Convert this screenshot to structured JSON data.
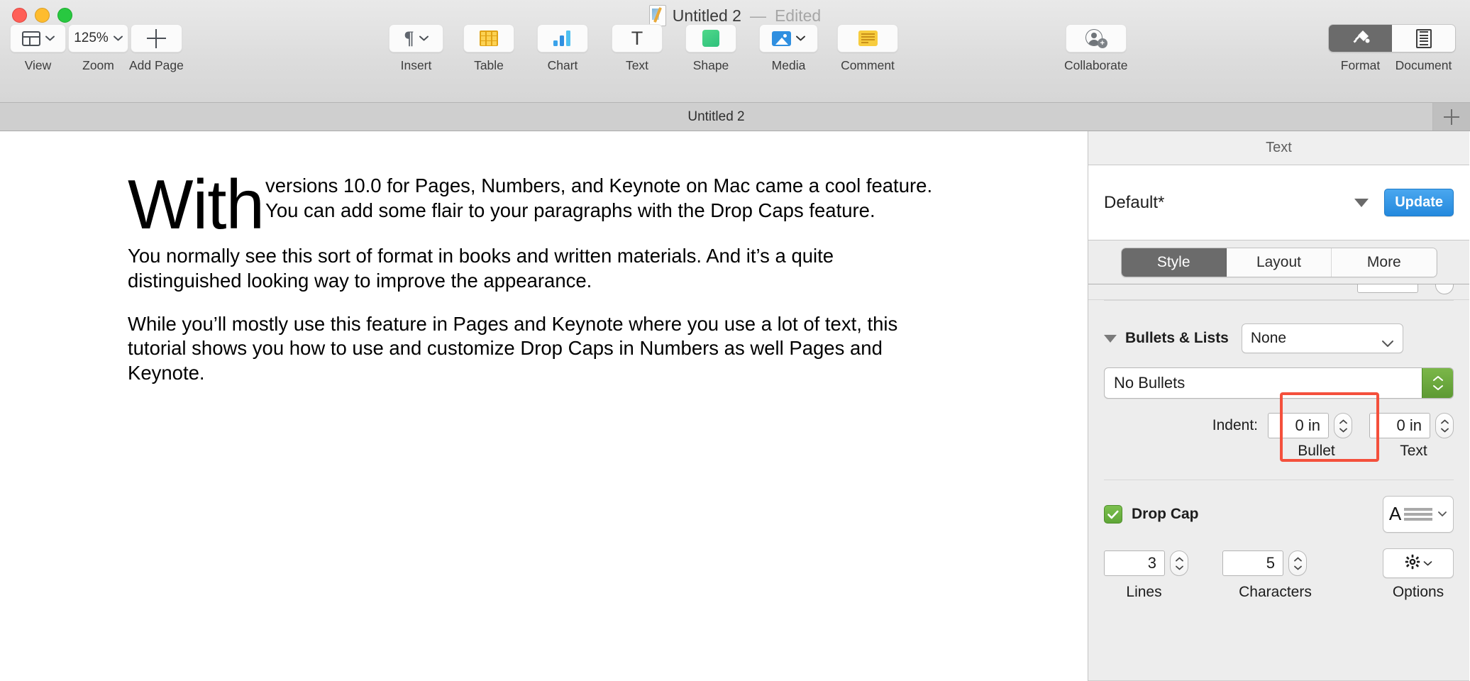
{
  "window": {
    "title_main": "Untitled 2",
    "title_sep": "—",
    "title_state": "Edited",
    "traffic_lights": [
      "close",
      "minimize",
      "zoom"
    ]
  },
  "toolbar": {
    "items": [
      {
        "name": "view",
        "label": "View",
        "icon": "sidebar-layout-icon",
        "has_chevron": true,
        "value": ""
      },
      {
        "name": "zoom",
        "label": "Zoom",
        "icon": "zoom-percent-icon",
        "has_chevron": true,
        "value": "125%"
      },
      {
        "name": "add-page",
        "label": "Add Page",
        "icon": "plus-icon",
        "has_chevron": false,
        "value": ""
      },
      {
        "name": "insert",
        "label": "Insert",
        "icon": "pilcrow-icon",
        "has_chevron": true,
        "value": "¶"
      },
      {
        "name": "table",
        "label": "Table",
        "icon": "table-grid-icon",
        "has_chevron": false,
        "value": ""
      },
      {
        "name": "chart",
        "label": "Chart",
        "icon": "bar-chart-icon",
        "has_chevron": false,
        "value": ""
      },
      {
        "name": "text",
        "label": "Text",
        "icon": "text-t-icon",
        "has_chevron": false,
        "value": "T"
      },
      {
        "name": "shape",
        "label": "Shape",
        "icon": "green-square-icon",
        "has_chevron": false,
        "value": ""
      },
      {
        "name": "media",
        "label": "Media",
        "icon": "photo-icon",
        "has_chevron": true,
        "value": ""
      },
      {
        "name": "comment",
        "label": "Comment",
        "icon": "sticky-note-icon",
        "has_chevron": false,
        "value": ""
      },
      {
        "name": "collaborate",
        "label": "Collaborate",
        "icon": "add-person-icon",
        "has_chevron": false,
        "value": ""
      }
    ],
    "right_segments": [
      {
        "name": "format",
        "label": "Format",
        "icon": "paint-brush-icon",
        "active": true
      },
      {
        "name": "document",
        "label": "Document",
        "icon": "document-page-icon",
        "active": false
      }
    ]
  },
  "tabbar": {
    "document_tab": "Untitled 2",
    "add_tab_icon": "plus-icon"
  },
  "document": {
    "drop_cap_text": "With",
    "paragraphs": [
      "versions 10.0 for Pages, Numbers, and Keynote on Mac came a cool feature. You can add some flair to your paragraphs with the Drop Caps feature.",
      "You normally see this sort of format in books and written materials. And it’s a quite distinguished looking way to improve the appearance.",
      "While you’ll mostly use this feature in Pages and Keynote where you use a lot of text, this tutorial shows you how to use and customize Drop Caps in Numbers as well Pages and Keynote."
    ]
  },
  "inspector": {
    "header_title": "Text",
    "style": {
      "name": "Default*",
      "caret_icon": "chevron-down-icon",
      "update_label": "Update"
    },
    "tabs": [
      {
        "name": "style",
        "label": "Style",
        "active": true
      },
      {
        "name": "layout",
        "label": "Layout",
        "active": false
      },
      {
        "name": "more",
        "label": "More",
        "active": false
      }
    ],
    "bullets": {
      "section_title": "Bullets & Lists",
      "disclosure_icon": "disclosure-triangle-open-icon",
      "preset": "None",
      "preset_chevron_icon": "chevron-down-icon",
      "bullet_type": "No Bullets",
      "stepper_icon": "stepper-up-down-icon",
      "indent_label": "Indent:",
      "bullet_indent_value": "0 in",
      "bullet_indent_sublabel": "Bullet",
      "text_indent_value": "0 in",
      "text_indent_sublabel": "Text"
    },
    "drop_cap": {
      "checkbox_checked": true,
      "check_icon": "checkmark-icon",
      "label": "Drop Cap",
      "preview_icon": "drop-cap-preview-icon",
      "preview_chevron_icon": "chevron-down-icon",
      "lines_value": "3",
      "lines_sublabel": "Lines",
      "characters_value": "5",
      "characters_sublabel": "Characters",
      "options_icon": "gear-icon",
      "options_chevron_icon": "chevron-down-icon",
      "options_sublabel": "Options"
    },
    "annotation": {
      "highlight_color": "#f4503c",
      "highlight_target": "characters-stepper-group"
    }
  }
}
